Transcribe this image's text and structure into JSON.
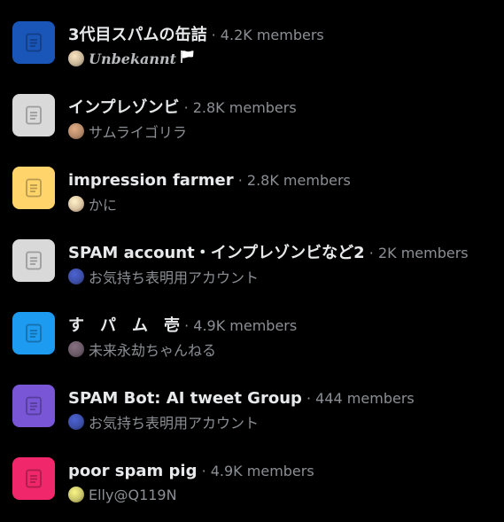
{
  "communities": [
    {
      "name": "3代目スパムの缶詰",
      "members": "· 4.2K members",
      "owner": "Unbekannt",
      "owner_flag_icon": "white-flag-icon",
      "tile_color": "#1a55b8",
      "tile_icon": "document-icon",
      "avatar_color": "#c9b79a"
    },
    {
      "name": "インプレゾンビ",
      "members": "· 2.8K members",
      "owner": "サムライゴリラ",
      "tile_color": "#d9d9d9",
      "tile_icon": "document-icon",
      "avatar_color": "#b58a6a"
    },
    {
      "name": "impression farmer",
      "members": "· 2.8K members",
      "owner": "かに",
      "tile_color": "#ffd46b",
      "tile_icon": "document-icon",
      "avatar_color": "#d9c2a0"
    },
    {
      "name": "SPAM account・インプレゾンビなど2",
      "members": "· 2K members",
      "owner": "お気持ち表明用アカウント",
      "tile_color": "#d9d9d9",
      "tile_icon": "document-icon",
      "avatar_color": "#3d4fa8"
    },
    {
      "name": "す　パ　ム　壱",
      "members": "· 4.9K members",
      "owner": "未来永劫ちゃんねる",
      "tile_color": "#1d9bf0",
      "tile_icon": "document-icon",
      "avatar_color": "#6b5a68"
    },
    {
      "name": "SPAM Bot: AI tweet Group",
      "members": "· 444 members",
      "owner": "お気持ち表明用アカウント",
      "tile_color": "#7856d6",
      "tile_icon": "document-icon",
      "avatar_color": "#3d4fa8"
    },
    {
      "name": "poor spam pig",
      "members": "· 4.9K members",
      "owner": "Elly@Q119N",
      "tile_color": "#f0276a",
      "tile_icon": "document-icon",
      "avatar_color": "#c8c46a"
    }
  ]
}
